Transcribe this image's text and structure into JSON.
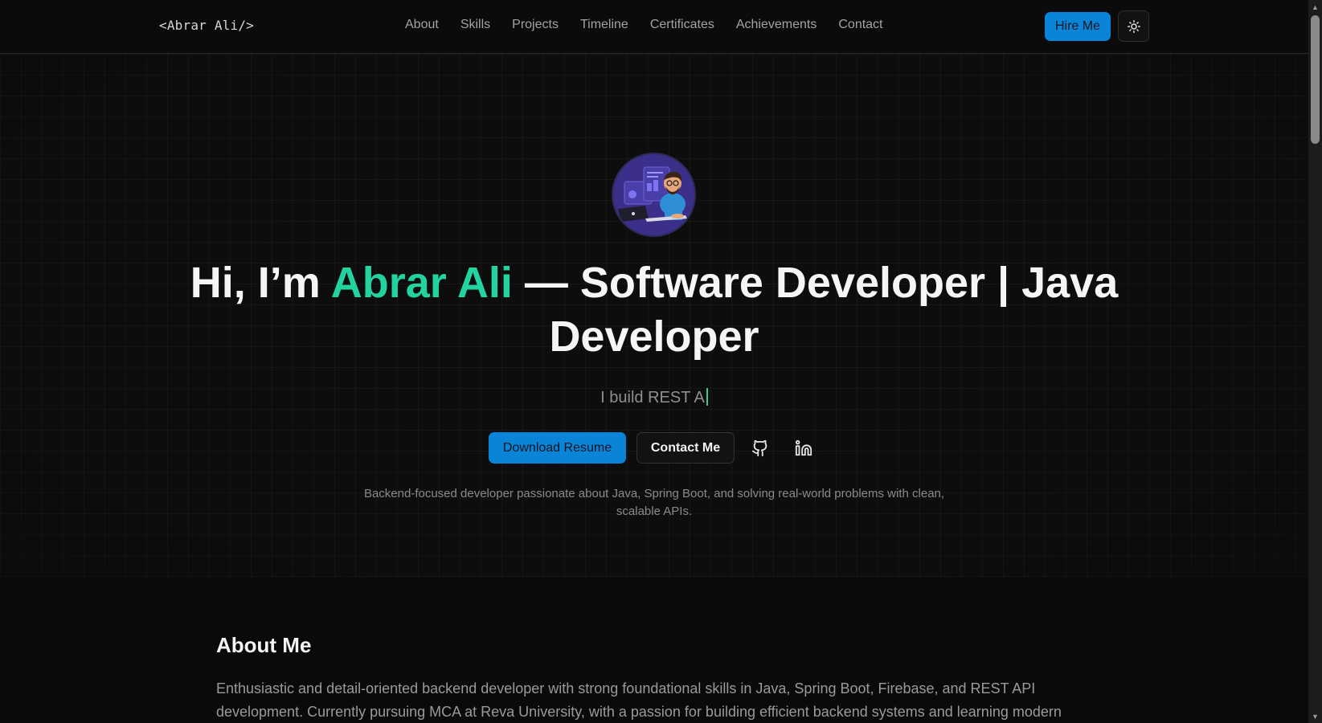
{
  "header": {
    "logo": "<Abrar Ali/>",
    "nav": [
      "About",
      "Skills",
      "Projects",
      "Timeline",
      "Certificates",
      "Achievements",
      "Contact"
    ],
    "hire_label": "Hire Me",
    "theme_icon": "sun-icon"
  },
  "hero": {
    "greeting": "Hi, I’m ",
    "name": "Abrar Ali",
    "title_rest": " — Software Developer | Java Developer",
    "typed_text": "I build REST A",
    "resume_label": "Download Resume",
    "contact_label": "Contact Me",
    "social_icons": [
      "github-icon",
      "linkedin-icon"
    ],
    "tagline": "Backend-focused developer passionate about Java, Spring Boot, and solving real-world problems with clean, scalable APIs."
  },
  "about": {
    "heading": "About Me",
    "body": "Enthusiastic and detail-oriented backend developer with strong foundational skills in Java, Spring Boot, Firebase, and REST API development. Currently pursuing MCA at Reva University, with a passion for building efficient backend systems and learning modern"
  },
  "colors": {
    "accent_green": "#22d3a0",
    "primary_blue": "#0a84d6",
    "background": "#0a0a0a"
  }
}
